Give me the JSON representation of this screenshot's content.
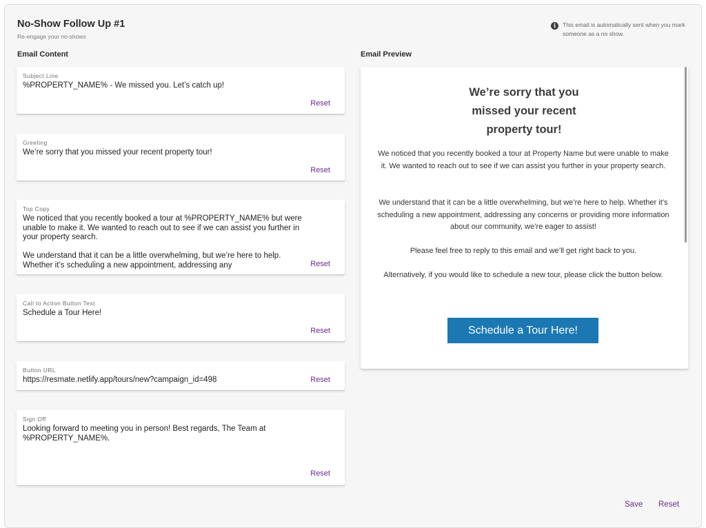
{
  "header": {
    "title": "No-Show Follow Up #1",
    "subtitle": "Re-engage your no-shows",
    "info_text": "This email is automatically sent when you mark someone as a no show.",
    "info_icon": "info-icon"
  },
  "sections": {
    "content_label": "Email Content",
    "preview_label": "Email Preview"
  },
  "fields": {
    "subject": {
      "label": "Subject Line",
      "value": "%PROPERTY_NAME% - We missed you. Let’s catch up!",
      "reset": "Reset"
    },
    "greeting": {
      "label": "Greeting",
      "value": "We’re sorry that you missed your recent property tour!",
      "reset": "Reset"
    },
    "top_copy": {
      "label": "Top Copy",
      "value": "We noticed that you recently booked a tour at %PROPERTY_NAME% but were unable to make it. We wanted to reach out to see if we can assist you further in your property search.\n\nWe understand that it can be a little overwhelming, but we’re here to help. Whether it’s scheduling a new appointment, addressing any",
      "reset": "Reset"
    },
    "cta_text": {
      "label": "Call to Action Button Text",
      "value": "Schedule a Tour Here!",
      "reset": "Reset"
    },
    "button_url": {
      "label": "Button URL",
      "value": "https://resmate.netlify.app/tours/new?campaign_id=498",
      "reset": "Reset"
    },
    "sign_off": {
      "label": "Sign Off",
      "value": "Looking forward to meeting you in person! Best regards, The Team at %PROPERTY_NAME%.",
      "reset": "Reset"
    }
  },
  "preview": {
    "heading": "We’re sorry that you missed your recent property tour!",
    "para1": "We noticed that you recently booked a tour at Property Name but were unable to make it. We wanted to reach out to see if we can assist you further in your property search.",
    "para2": "We understand that it can be a little overwhelming, but we’re here to help. Whether it’s scheduling a new appointment, addressing any concerns or providing more information about our community, we’re eager to assist!",
    "para3": "Please feel free to reply to this email and we’ll get right back to you.",
    "para4": "Alternatively, if you would like to schedule a new tour, please click the button below.",
    "cta": "Schedule a Tour Here!"
  },
  "footer": {
    "save": "Save",
    "reset": "Reset"
  },
  "colors": {
    "accent": "#6a2a8c",
    "cta_bg": "#1b78b3",
    "panel_bg": "#f6f6f7"
  }
}
